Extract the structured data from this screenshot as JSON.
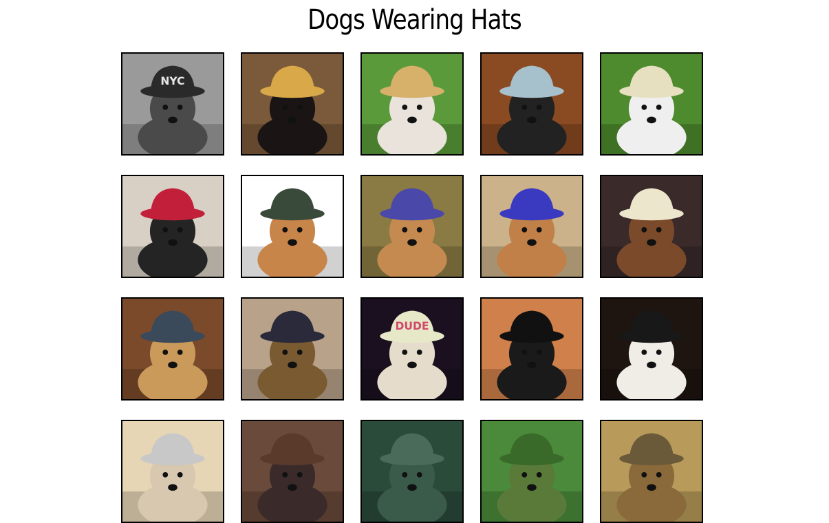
{
  "page": {
    "title": "Dogs Wearing Hats"
  },
  "photos": [
    {
      "bg": "#9a9a9a",
      "dog": "#4a4a4a",
      "hat": "#2a2a2a",
      "label": "NYC",
      "label_color": "#e8e8e8"
    },
    {
      "bg": "#7a5a3a",
      "dog": "#1a1414",
      "hat": "#d9a848",
      "label": "",
      "label_color": ""
    },
    {
      "bg": "#5a9a3a",
      "dog": "#e9e3dc",
      "hat": "#d7b06a",
      "label": "",
      "label_color": ""
    },
    {
      "bg": "#8a4a22",
      "dog": "#222222",
      "hat": "#a6c0cc",
      "label": "",
      "label_color": ""
    },
    {
      "bg": "#4e8a2e",
      "dog": "#efefef",
      "hat": "#e6e0c0",
      "label": "",
      "label_color": ""
    },
    {
      "bg": "#d8d0c4",
      "dog": "#242424",
      "hat": "#c2203a",
      "label": "",
      "label_color": ""
    },
    {
      "bg": "#ffffff",
      "dog": "#c8854a",
      "hat": "#3a4a3a",
      "label": "",
      "label_color": ""
    },
    {
      "bg": "#8a7a44",
      "dog": "#c48a50",
      "hat": "#4a48a8",
      "label": "",
      "label_color": ""
    },
    {
      "bg": "#cbb28a",
      "dog": "#c08048",
      "hat": "#3a3ac0",
      "label": "",
      "label_color": ""
    },
    {
      "bg": "#3a2a2a",
      "dog": "#7a4a2a",
      "hat": "#ece6cc",
      "label": "",
      "label_color": ""
    },
    {
      "bg": "#7a4a2a",
      "dog": "#c99a5a",
      "hat": "#3a4a5a",
      "label": "",
      "label_color": ""
    },
    {
      "bg": "#b8a28a",
      "dog": "#7a5a30",
      "hat": "#2a2a3a",
      "label": "",
      "label_color": ""
    },
    {
      "bg": "#1a1020",
      "dog": "#e6dccc",
      "hat": "#e6e8c8",
      "label": "DUDE",
      "label_color": "#d04a6a"
    },
    {
      "bg": "#d0804a",
      "dog": "#1a1a1a",
      "hat": "#111111",
      "label": "",
      "label_color": ""
    },
    {
      "bg": "#1e1410",
      "dog": "#f0ece6",
      "hat": "#181818",
      "label": "",
      "label_color": ""
    },
    {
      "bg": "#e6d6b6",
      "dog": "#d8c8b0",
      "hat": "#c8c8c8",
      "label": "",
      "label_color": ""
    },
    {
      "bg": "#6a4a3a",
      "dog": "#3a2a2a",
      "hat": "#5a3a2a",
      "label": "",
      "label_color": ""
    },
    {
      "bg": "#2a4a3a",
      "dog": "#3a5a4a",
      "hat": "#4a6a5a",
      "label": "",
      "label_color": ""
    },
    {
      "bg": "#4a8a3a",
      "dog": "#5a7a3a",
      "hat": "#3a6a2a",
      "label": "",
      "label_color": ""
    },
    {
      "bg": "#b89a5a",
      "dog": "#8a6a3a",
      "hat": "#6a5a3a",
      "label": "",
      "label_color": ""
    }
  ]
}
